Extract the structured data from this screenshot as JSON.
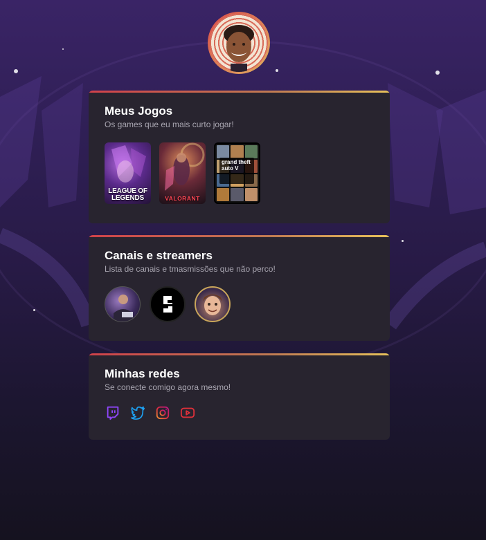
{
  "profile": {
    "avatar_alt": "profile-avatar"
  },
  "games_card": {
    "title": "Meus Jogos",
    "subtitle": "Os games que eu mais curto jogar!",
    "games": [
      {
        "name": "League of Legends",
        "cover_text": "LEAGUE OF LEGENDS"
      },
      {
        "name": "Valorant",
        "cover_text": "VALORANT"
      },
      {
        "name": "Grand Theft Auto V",
        "cover_text": "grand theft auto V"
      }
    ]
  },
  "streamers_card": {
    "title": "Canais e streamers",
    "subtitle": "Lista de canais e tmasmissões que não perco!",
    "streamers": [
      {
        "name": "streamer-1"
      },
      {
        "name": "streamer-2"
      },
      {
        "name": "streamer-3"
      }
    ]
  },
  "social_card": {
    "title": "Minhas redes",
    "subtitle": "Se conecte comigo agora mesmo!",
    "links": [
      {
        "icon": "twitch-icon",
        "color": "#9146ff"
      },
      {
        "icon": "twitter-icon",
        "color": "#1da1f2"
      },
      {
        "icon": "instagram-icon",
        "color": "#e1306c"
      },
      {
        "icon": "youtube-icon",
        "color": "#e0303a"
      }
    ]
  },
  "colors": {
    "accent_start": "#d0424a",
    "accent_end": "#e8c25a",
    "card_bg": "#28242f"
  }
}
